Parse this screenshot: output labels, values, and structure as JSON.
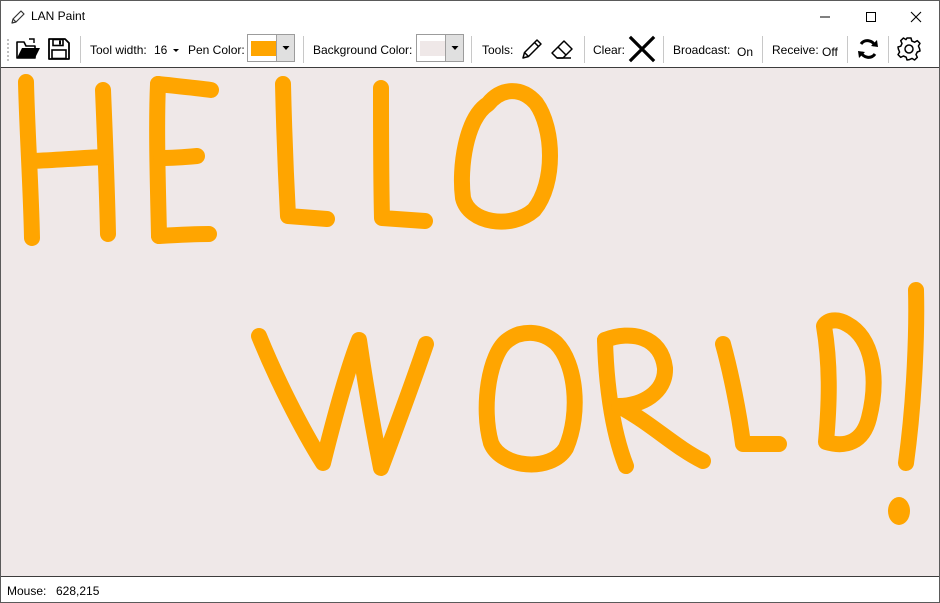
{
  "window": {
    "title": "LAN Paint"
  },
  "toolbar": {
    "open_icon": "open-folder-icon",
    "save_icon": "save-icon",
    "tool_width_label": "Tool width:",
    "tool_width_value": "16",
    "pen_color_label": "Pen Color:",
    "pen_color": "#ffa500",
    "background_color_label": "Background Color:",
    "background_color": "#efe8e8",
    "tools_label": "Tools:",
    "pencil_icon": "pencil-icon",
    "eraser_icon": "eraser-icon",
    "clear_label": "Clear:",
    "clear_icon": "x-icon",
    "broadcast_label": "Broadcast:",
    "broadcast_value": "On",
    "receive_label": "Receive:",
    "receive_value": "Off",
    "refresh_icon": "refresh-icon",
    "settings_icon": "gear-icon"
  },
  "canvas": {
    "stroke_color": "#ffa500",
    "drawing": "HELLO WORLD!"
  },
  "statusbar": {
    "mouse_label": "Mouse:",
    "mouse_value": "628,215"
  }
}
